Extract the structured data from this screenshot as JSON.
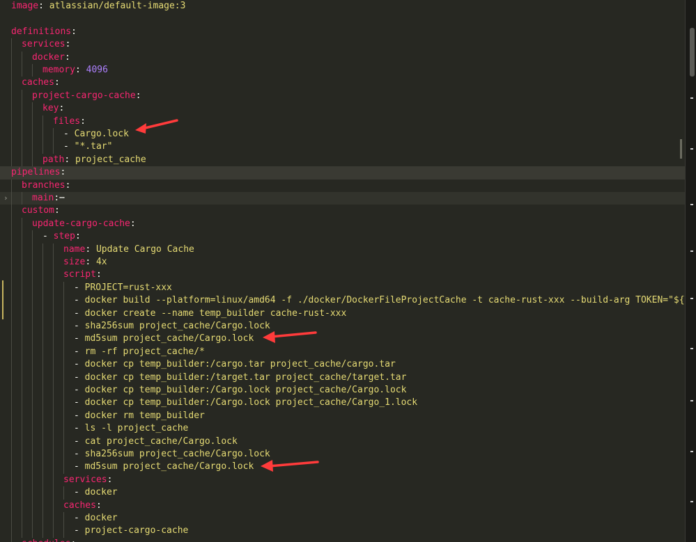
{
  "editor": {
    "lines": [
      {
        "indent": 0,
        "segments": [
          {
            "t": "image",
            "c": "k"
          },
          {
            "t": ": ",
            "c": "p"
          },
          {
            "t": "atlassian/default-image:3",
            "c": "s"
          }
        ]
      },
      {
        "indent": 0,
        "segments": []
      },
      {
        "indent": 0,
        "segments": [
          {
            "t": "definitions",
            "c": "k"
          },
          {
            "t": ":",
            "c": "p"
          }
        ]
      },
      {
        "indent": 1,
        "segments": [
          {
            "t": "services",
            "c": "k"
          },
          {
            "t": ":",
            "c": "p"
          }
        ]
      },
      {
        "indent": 2,
        "segments": [
          {
            "t": "docker",
            "c": "k"
          },
          {
            "t": ":",
            "c": "p"
          }
        ]
      },
      {
        "indent": 3,
        "segments": [
          {
            "t": "memory",
            "c": "k"
          },
          {
            "t": ": ",
            "c": "p"
          },
          {
            "t": "4096",
            "c": "n"
          }
        ]
      },
      {
        "indent": 1,
        "segments": [
          {
            "t": "caches",
            "c": "k"
          },
          {
            "t": ":",
            "c": "p"
          }
        ]
      },
      {
        "indent": 2,
        "segments": [
          {
            "t": "project-cargo-cache",
            "c": "k"
          },
          {
            "t": ":",
            "c": "p"
          }
        ]
      },
      {
        "indent": 3,
        "segments": [
          {
            "t": "key",
            "c": "k"
          },
          {
            "t": ":",
            "c": "p"
          }
        ]
      },
      {
        "indent": 4,
        "segments": [
          {
            "t": "files",
            "c": "k"
          },
          {
            "t": ":",
            "c": "p"
          }
        ]
      },
      {
        "indent": 5,
        "segments": [
          {
            "t": "- ",
            "c": "p"
          },
          {
            "t": "Cargo.lock",
            "c": "s"
          }
        ]
      },
      {
        "indent": 5,
        "segments": [
          {
            "t": "- ",
            "c": "p"
          },
          {
            "t": "\"*.tar\"",
            "c": "s"
          }
        ]
      },
      {
        "indent": 3,
        "segments": [
          {
            "t": "path",
            "c": "k"
          },
          {
            "t": ": ",
            "c": "p"
          },
          {
            "t": "project_cache",
            "c": "s"
          }
        ]
      },
      {
        "indent": 0,
        "hl": "hl",
        "segments": [
          {
            "t": "pipelines",
            "c": "k"
          },
          {
            "t": ":",
            "c": "p"
          }
        ]
      },
      {
        "indent": 1,
        "segments": [
          {
            "t": "branches",
            "c": "k"
          },
          {
            "t": ":",
            "c": "p"
          }
        ]
      },
      {
        "indent": 2,
        "hl": "hl2",
        "fold": "›",
        "segments": [
          {
            "t": "main",
            "c": "k"
          },
          {
            "t": ":",
            "c": "p"
          },
          {
            "t": "⋯",
            "c": "p"
          }
        ]
      },
      {
        "indent": 1,
        "segments": [
          {
            "t": "custom",
            "c": "k"
          },
          {
            "t": ":",
            "c": "p"
          }
        ]
      },
      {
        "indent": 2,
        "segments": [
          {
            "t": "update-cargo-cache",
            "c": "k"
          },
          {
            "t": ":",
            "c": "p"
          }
        ]
      },
      {
        "indent": 3,
        "segments": [
          {
            "t": "- ",
            "c": "p"
          },
          {
            "t": "step",
            "c": "k"
          },
          {
            "t": ":",
            "c": "p"
          }
        ]
      },
      {
        "indent": 5,
        "segments": [
          {
            "t": "name",
            "c": "k"
          },
          {
            "t": ": ",
            "c": "p"
          },
          {
            "t": "Update Cargo Cache",
            "c": "s"
          }
        ]
      },
      {
        "indent": 5,
        "segments": [
          {
            "t": "size",
            "c": "k"
          },
          {
            "t": ": ",
            "c": "p"
          },
          {
            "t": "4x",
            "c": "s"
          }
        ]
      },
      {
        "indent": 5,
        "segments": [
          {
            "t": "script",
            "c": "k"
          },
          {
            "t": ":",
            "c": "p"
          }
        ]
      },
      {
        "indent": 6,
        "segments": [
          {
            "t": "- ",
            "c": "p"
          },
          {
            "t": "PROJECT=rust-xxx",
            "c": "s"
          }
        ]
      },
      {
        "indent": 6,
        "segments": [
          {
            "t": "- ",
            "c": "p"
          },
          {
            "t": "docker build --platform=linux/amd64 -f ./docker/DockerFileProjectCache -t cache-rust-xxx --build-arg TOKEN=\"${TOKEN}\"",
            "c": "s"
          }
        ]
      },
      {
        "indent": 6,
        "segments": [
          {
            "t": "- ",
            "c": "p"
          },
          {
            "t": "docker create --name temp_builder cache-rust-xxx",
            "c": "s"
          }
        ]
      },
      {
        "indent": 6,
        "segments": [
          {
            "t": "- ",
            "c": "p"
          },
          {
            "t": "sha256sum project_cache/Cargo.lock",
            "c": "s"
          }
        ]
      },
      {
        "indent": 6,
        "segments": [
          {
            "t": "- ",
            "c": "p"
          },
          {
            "t": "md5sum project_cache/Cargo.lock",
            "c": "s"
          }
        ]
      },
      {
        "indent": 6,
        "segments": [
          {
            "t": "- ",
            "c": "p"
          },
          {
            "t": "rm -rf project_cache/*",
            "c": "s"
          }
        ]
      },
      {
        "indent": 6,
        "segments": [
          {
            "t": "- ",
            "c": "p"
          },
          {
            "t": "docker cp temp_builder:/cargo.tar project_cache/cargo.tar",
            "c": "s"
          }
        ]
      },
      {
        "indent": 6,
        "segments": [
          {
            "t": "- ",
            "c": "p"
          },
          {
            "t": "docker cp temp_builder:/target.tar project_cache/target.tar",
            "c": "s"
          }
        ]
      },
      {
        "indent": 6,
        "segments": [
          {
            "t": "- ",
            "c": "p"
          },
          {
            "t": "docker cp temp_builder:/Cargo.lock project_cache/Cargo.lock",
            "c": "s"
          }
        ]
      },
      {
        "indent": 6,
        "segments": [
          {
            "t": "- ",
            "c": "p"
          },
          {
            "t": "docker cp temp_builder:/Cargo.lock project_cache/Cargo_1.lock",
            "c": "s"
          }
        ]
      },
      {
        "indent": 6,
        "segments": [
          {
            "t": "- ",
            "c": "p"
          },
          {
            "t": "docker rm temp_builder",
            "c": "s"
          }
        ]
      },
      {
        "indent": 6,
        "segments": [
          {
            "t": "- ",
            "c": "p"
          },
          {
            "t": "ls -l project_cache",
            "c": "s"
          }
        ]
      },
      {
        "indent": 6,
        "segments": [
          {
            "t": "- ",
            "c": "p"
          },
          {
            "t": "cat project_cache/Cargo.lock",
            "c": "s"
          }
        ]
      },
      {
        "indent": 6,
        "segments": [
          {
            "t": "- ",
            "c": "p"
          },
          {
            "t": "sha256sum project_cache/Cargo.lock",
            "c": "s"
          }
        ]
      },
      {
        "indent": 6,
        "segments": [
          {
            "t": "- ",
            "c": "p"
          },
          {
            "t": "md5sum project_cache/Cargo.lock",
            "c": "s"
          }
        ]
      },
      {
        "indent": 5,
        "segments": [
          {
            "t": "services",
            "c": "k"
          },
          {
            "t": ":",
            "c": "p"
          }
        ]
      },
      {
        "indent": 6,
        "segments": [
          {
            "t": "- ",
            "c": "p"
          },
          {
            "t": "docker",
            "c": "s"
          }
        ]
      },
      {
        "indent": 5,
        "segments": [
          {
            "t": "caches",
            "c": "k"
          },
          {
            "t": ":",
            "c": "p"
          }
        ]
      },
      {
        "indent": 6,
        "segments": [
          {
            "t": "- ",
            "c": "p"
          },
          {
            "t": "docker",
            "c": "s"
          }
        ]
      },
      {
        "indent": 6,
        "segments": [
          {
            "t": "- ",
            "c": "p"
          },
          {
            "t": "project-cargo-cache",
            "c": "s"
          }
        ]
      },
      {
        "indent": 1,
        "segments": [
          {
            "t": "schedules",
            "c": "k"
          },
          {
            "t": ":",
            "c": "p"
          }
        ]
      }
    ]
  },
  "colors": {
    "background": "#272822",
    "key": "#f92672",
    "string": "#e6db74",
    "number": "#ae81ff",
    "annotation_arrow": "#ff3b3b"
  },
  "annotations": [
    {
      "icon": "red-arrow-icon",
      "points_to": "Cargo.lock"
    },
    {
      "icon": "red-arrow-icon",
      "points_to": "md5sum project_cache/Cargo.lock"
    },
    {
      "icon": "red-arrow-icon",
      "points_to": "md5sum project_cache/Cargo.lock"
    }
  ]
}
